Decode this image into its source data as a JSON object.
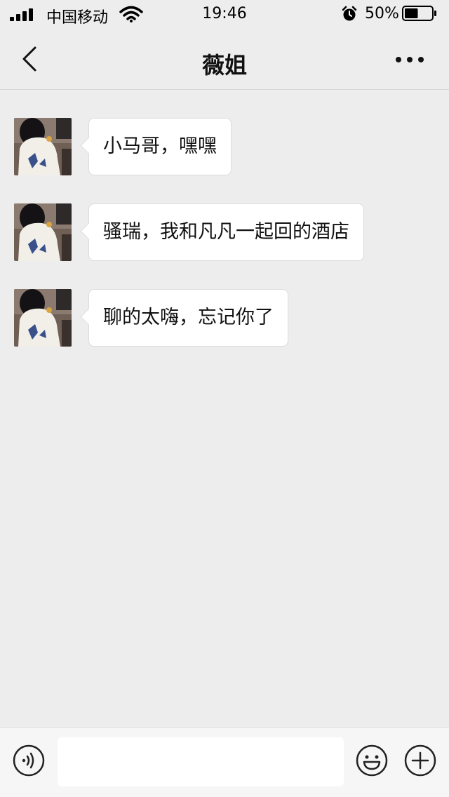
{
  "status_bar": {
    "carrier": "中国移动",
    "time": "19:46",
    "battery_percent": "50%",
    "battery_level": 0.5,
    "icons": [
      "signal-icon",
      "wifi-icon",
      "alarm-icon",
      "battery-icon"
    ]
  },
  "nav": {
    "title": "薇姐",
    "back_icon": "chevron-left-icon",
    "more_icon": "more-dots-icon"
  },
  "messages": [
    {
      "sender": "薇姐",
      "text": "小马哥，嘿嘿"
    },
    {
      "sender": "薇姐",
      "text": "骚瑞，我和凡凡一起回的酒店"
    },
    {
      "sender": "薇姐",
      "text": "聊的太嗨，忘记你了"
    }
  ],
  "input_bar": {
    "value": "",
    "placeholder": "",
    "icons": [
      "voice-icon",
      "emoji-icon",
      "plus-icon"
    ]
  },
  "colors": {
    "background": "#ededed",
    "bubble": "#ffffff",
    "input_bar": "#f6f6f6"
  }
}
